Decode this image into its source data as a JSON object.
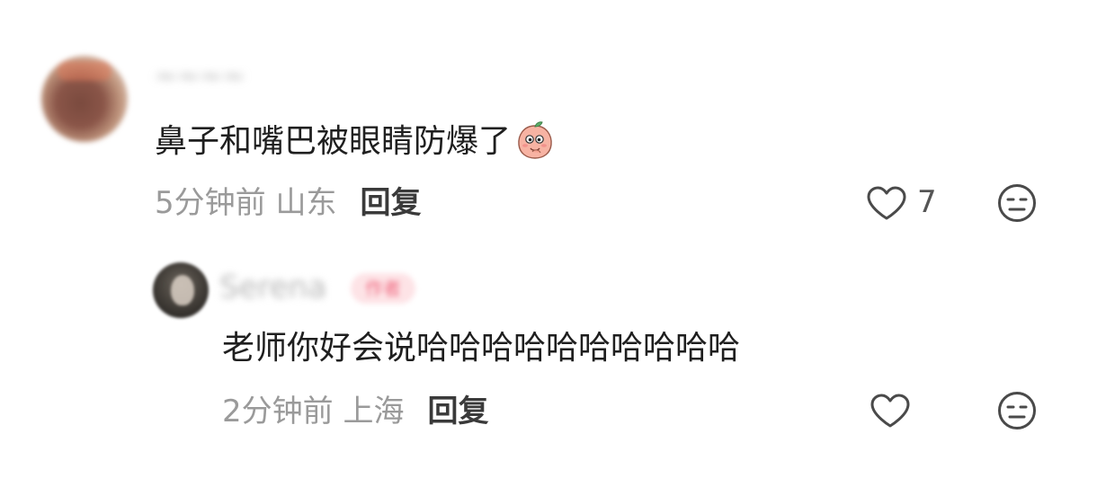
{
  "comments": [
    {
      "username": "~~~~",
      "text": "鼻子和嘴巴被眼睛防爆了",
      "emoji": "peach-shy-emoji",
      "time_location": "5分钟前 山东",
      "reply_label": "回复",
      "like_count": "7"
    },
    {
      "username": "Serena",
      "badge": "作者",
      "text": "老师你好会说哈哈哈哈哈哈哈哈哈哈",
      "time_location": "2分钟前 上海",
      "reply_label": "回复"
    }
  ],
  "colors": {
    "text": "#1f1f1f",
    "meta": "#9a9a9a",
    "reply": "#3a3a3a",
    "icon": "#4a4a4a",
    "badge_bg": "#fde3e6",
    "badge_text": "#f06b82"
  }
}
